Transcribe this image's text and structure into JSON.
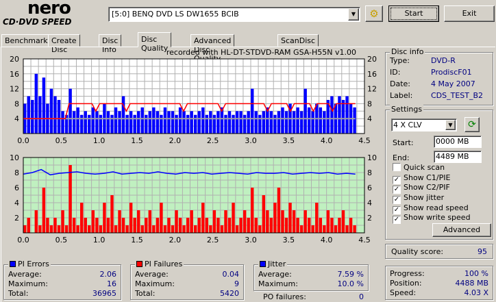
{
  "logo": {
    "line1": "nero",
    "line2": "CD·DVD SPEED"
  },
  "drive": {
    "selected": "[5:0]  BENQ DVD LS DW1655 BCIB"
  },
  "buttons": {
    "start": "Start",
    "exit": "Exit",
    "advanced": "Advanced"
  },
  "tabs": [
    "Benchmark",
    "Create Disc",
    "Disc Info",
    "Disc Quality",
    "Advanced Disc Quality",
    "ScanDisc"
  ],
  "active_tab": "Disc Quality",
  "chart_caption": "recorded with HL-DT-STDVD-RAM GSA-H55N v1.00",
  "disc_info": {
    "title": "Disc info",
    "rows": [
      {
        "k": "Type:",
        "v": "DVD-R"
      },
      {
        "k": "ID:",
        "v": "ProdiscF01"
      },
      {
        "k": "Date:",
        "v": "4 May 2007"
      },
      {
        "k": "Label:",
        "v": "CDS_TEST_B2"
      }
    ]
  },
  "settings": {
    "title": "Settings",
    "speed": "4 X CLV",
    "start_label": "Start:",
    "start": "0000 MB",
    "end_label": "End:",
    "end": "4489 MB",
    "checks": [
      {
        "label": "Quick scan",
        "checked": false
      },
      {
        "label": "Show C1/PIE",
        "checked": true
      },
      {
        "label": "Show C2/PIF",
        "checked": true
      },
      {
        "label": "Show jitter",
        "checked": true
      },
      {
        "label": "Show read speed",
        "checked": true
      },
      {
        "label": "Show write speed",
        "checked": true
      }
    ]
  },
  "quality": {
    "label": "Quality score:",
    "value": "95"
  },
  "pi_errors": {
    "title": "PI Errors",
    "color": "#0000ff",
    "rows": [
      {
        "k": "Average:",
        "v": "2.06"
      },
      {
        "k": "Maximum:",
        "v": "16"
      },
      {
        "k": "Total:",
        "v": "36965"
      }
    ]
  },
  "pi_failures": {
    "title": "PI Failures",
    "color": "#ff0000",
    "rows": [
      {
        "k": "Average:",
        "v": "0.04"
      },
      {
        "k": "Maximum:",
        "v": "9"
      },
      {
        "k": "Total:",
        "v": "5420"
      }
    ]
  },
  "jitter": {
    "title": "Jitter",
    "color": "#0000ff",
    "rows": [
      {
        "k": "Average:",
        "v": "7.59 %"
      },
      {
        "k": "Maximum:",
        "v": "10.0 %"
      }
    ],
    "po_label": "PO failures:",
    "po_value": "0"
  },
  "progress": {
    "rows": [
      {
        "k": "Progress:",
        "v": "100 %"
      },
      {
        "k": "Position:",
        "v": "4488 MB"
      },
      {
        "k": "Speed:",
        "v": "4.03 X"
      }
    ]
  },
  "chart_data": [
    {
      "type": "bar",
      "title": "PI Errors / read speed",
      "xlabel": "GB",
      "xlim": [
        0,
        4.5
      ],
      "ylim": [
        0,
        20
      ],
      "xticks": [
        "0.0",
        "0.5",
        "1.0",
        "1.5",
        "2.0",
        "2.5",
        "3.0",
        "3.5",
        "4.0",
        "4.5"
      ],
      "yticks": [
        "4",
        "8",
        "12",
        "16",
        "20"
      ],
      "x_step": 0.05,
      "pie": [
        8,
        10,
        9,
        16,
        10,
        15,
        8,
        12,
        10,
        9,
        6,
        5,
        12,
        6,
        7,
        5,
        6,
        5,
        7,
        6,
        5,
        8,
        6,
        5,
        7,
        6,
        10,
        5,
        6,
        5,
        6,
        7,
        5,
        6,
        7,
        6,
        5,
        7,
        6,
        6,
        5,
        7,
        6,
        5,
        6,
        5,
        6,
        7,
        5,
        6,
        5,
        6,
        7,
        5,
        6,
        5,
        6,
        6,
        5,
        6,
        12,
        6,
        5,
        6,
        7,
        6,
        5,
        6,
        7,
        6,
        8,
        6,
        7,
        6,
        12,
        7,
        6,
        8,
        7,
        6,
        9,
        10,
        8,
        10,
        9,
        10,
        8,
        7
      ],
      "read_speed": [
        4,
        4,
        4,
        4,
        4,
        4,
        4,
        4,
        4,
        4,
        4,
        4,
        8,
        8,
        8,
        8,
        8,
        8,
        8,
        6,
        8,
        8,
        8,
        8,
        8,
        8,
        8,
        6,
        8,
        8,
        8,
        8,
        8,
        8,
        8,
        8,
        8,
        8,
        8,
        8,
        8,
        8,
        6,
        8,
        8,
        8,
        8,
        8,
        8,
        8,
        8,
        8,
        6,
        8,
        8,
        8,
        8,
        8,
        8,
        8,
        8,
        8,
        8,
        8,
        6,
        8,
        8,
        8,
        8,
        8,
        6,
        8,
        8,
        8,
        8,
        8,
        6,
        8,
        8,
        8,
        8,
        6,
        8,
        8,
        8,
        8,
        8,
        8
      ],
      "write_speed": 4
    },
    {
      "type": "bar",
      "title": "PI Failures / jitter",
      "xlabel": "GB",
      "xlim": [
        0,
        4.5
      ],
      "ylim": [
        0,
        10
      ],
      "xticks": [
        "0.0",
        "0.5",
        "1.0",
        "1.5",
        "2.0",
        "2.5",
        "3.0",
        "3.5",
        "4.0",
        "4.5"
      ],
      "yticks": [
        "2",
        "4",
        "6",
        "8",
        "10"
      ],
      "x_step": 0.05,
      "pif": [
        1,
        2,
        0,
        3,
        1,
        6,
        2,
        1,
        2,
        1,
        3,
        1,
        9,
        2,
        1,
        4,
        2,
        1,
        3,
        2,
        1,
        4,
        2,
        5,
        1,
        3,
        2,
        1,
        4,
        2,
        3,
        1,
        2,
        3,
        1,
        2,
        4,
        1,
        2,
        1,
        3,
        2,
        1,
        2,
        3,
        1,
        2,
        4,
        2,
        1,
        3,
        2,
        1,
        3,
        2,
        4,
        1,
        2,
        3,
        2,
        6,
        2,
        1,
        5,
        3,
        2,
        4,
        6,
        3,
        2,
        4,
        3,
        2,
        1,
        3,
        2,
        1,
        4,
        2,
        1,
        3,
        2,
        1,
        2,
        3,
        1,
        2,
        1
      ],
      "jitter": [
        7.8,
        8.0,
        8.4,
        7.7,
        7.9,
        8.0,
        8.1,
        7.9,
        7.8,
        7.9,
        8.1,
        7.8,
        7.9,
        8.0,
        7.9,
        8.1,
        7.9,
        7.8,
        8.0,
        7.9,
        8.0,
        7.8,
        7.9,
        8.0,
        7.9,
        7.8,
        8.0,
        7.9,
        7.9,
        8.0,
        7.8,
        7.9,
        8.0,
        7.9,
        8.0,
        7.8,
        7.9,
        7.8
      ]
    }
  ]
}
